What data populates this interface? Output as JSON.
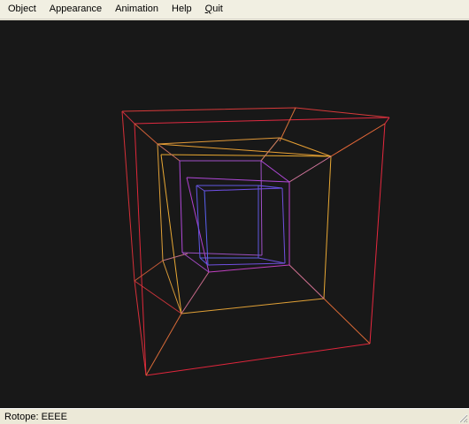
{
  "menubar": {
    "items": [
      {
        "label": "Object"
      },
      {
        "label": "Appearance"
      },
      {
        "label": "Animation"
      },
      {
        "label": "Help"
      },
      {
        "label": "Quit",
        "mnemonic": "Q"
      }
    ]
  },
  "viewport": {
    "background": "#181818",
    "object_colors": {
      "outer": "#e02a36",
      "middle": "#e8a030",
      "inner": "#9040e0",
      "innermost": "#5060f0"
    }
  },
  "statusbar": {
    "text": "Rotope: EEEE"
  }
}
